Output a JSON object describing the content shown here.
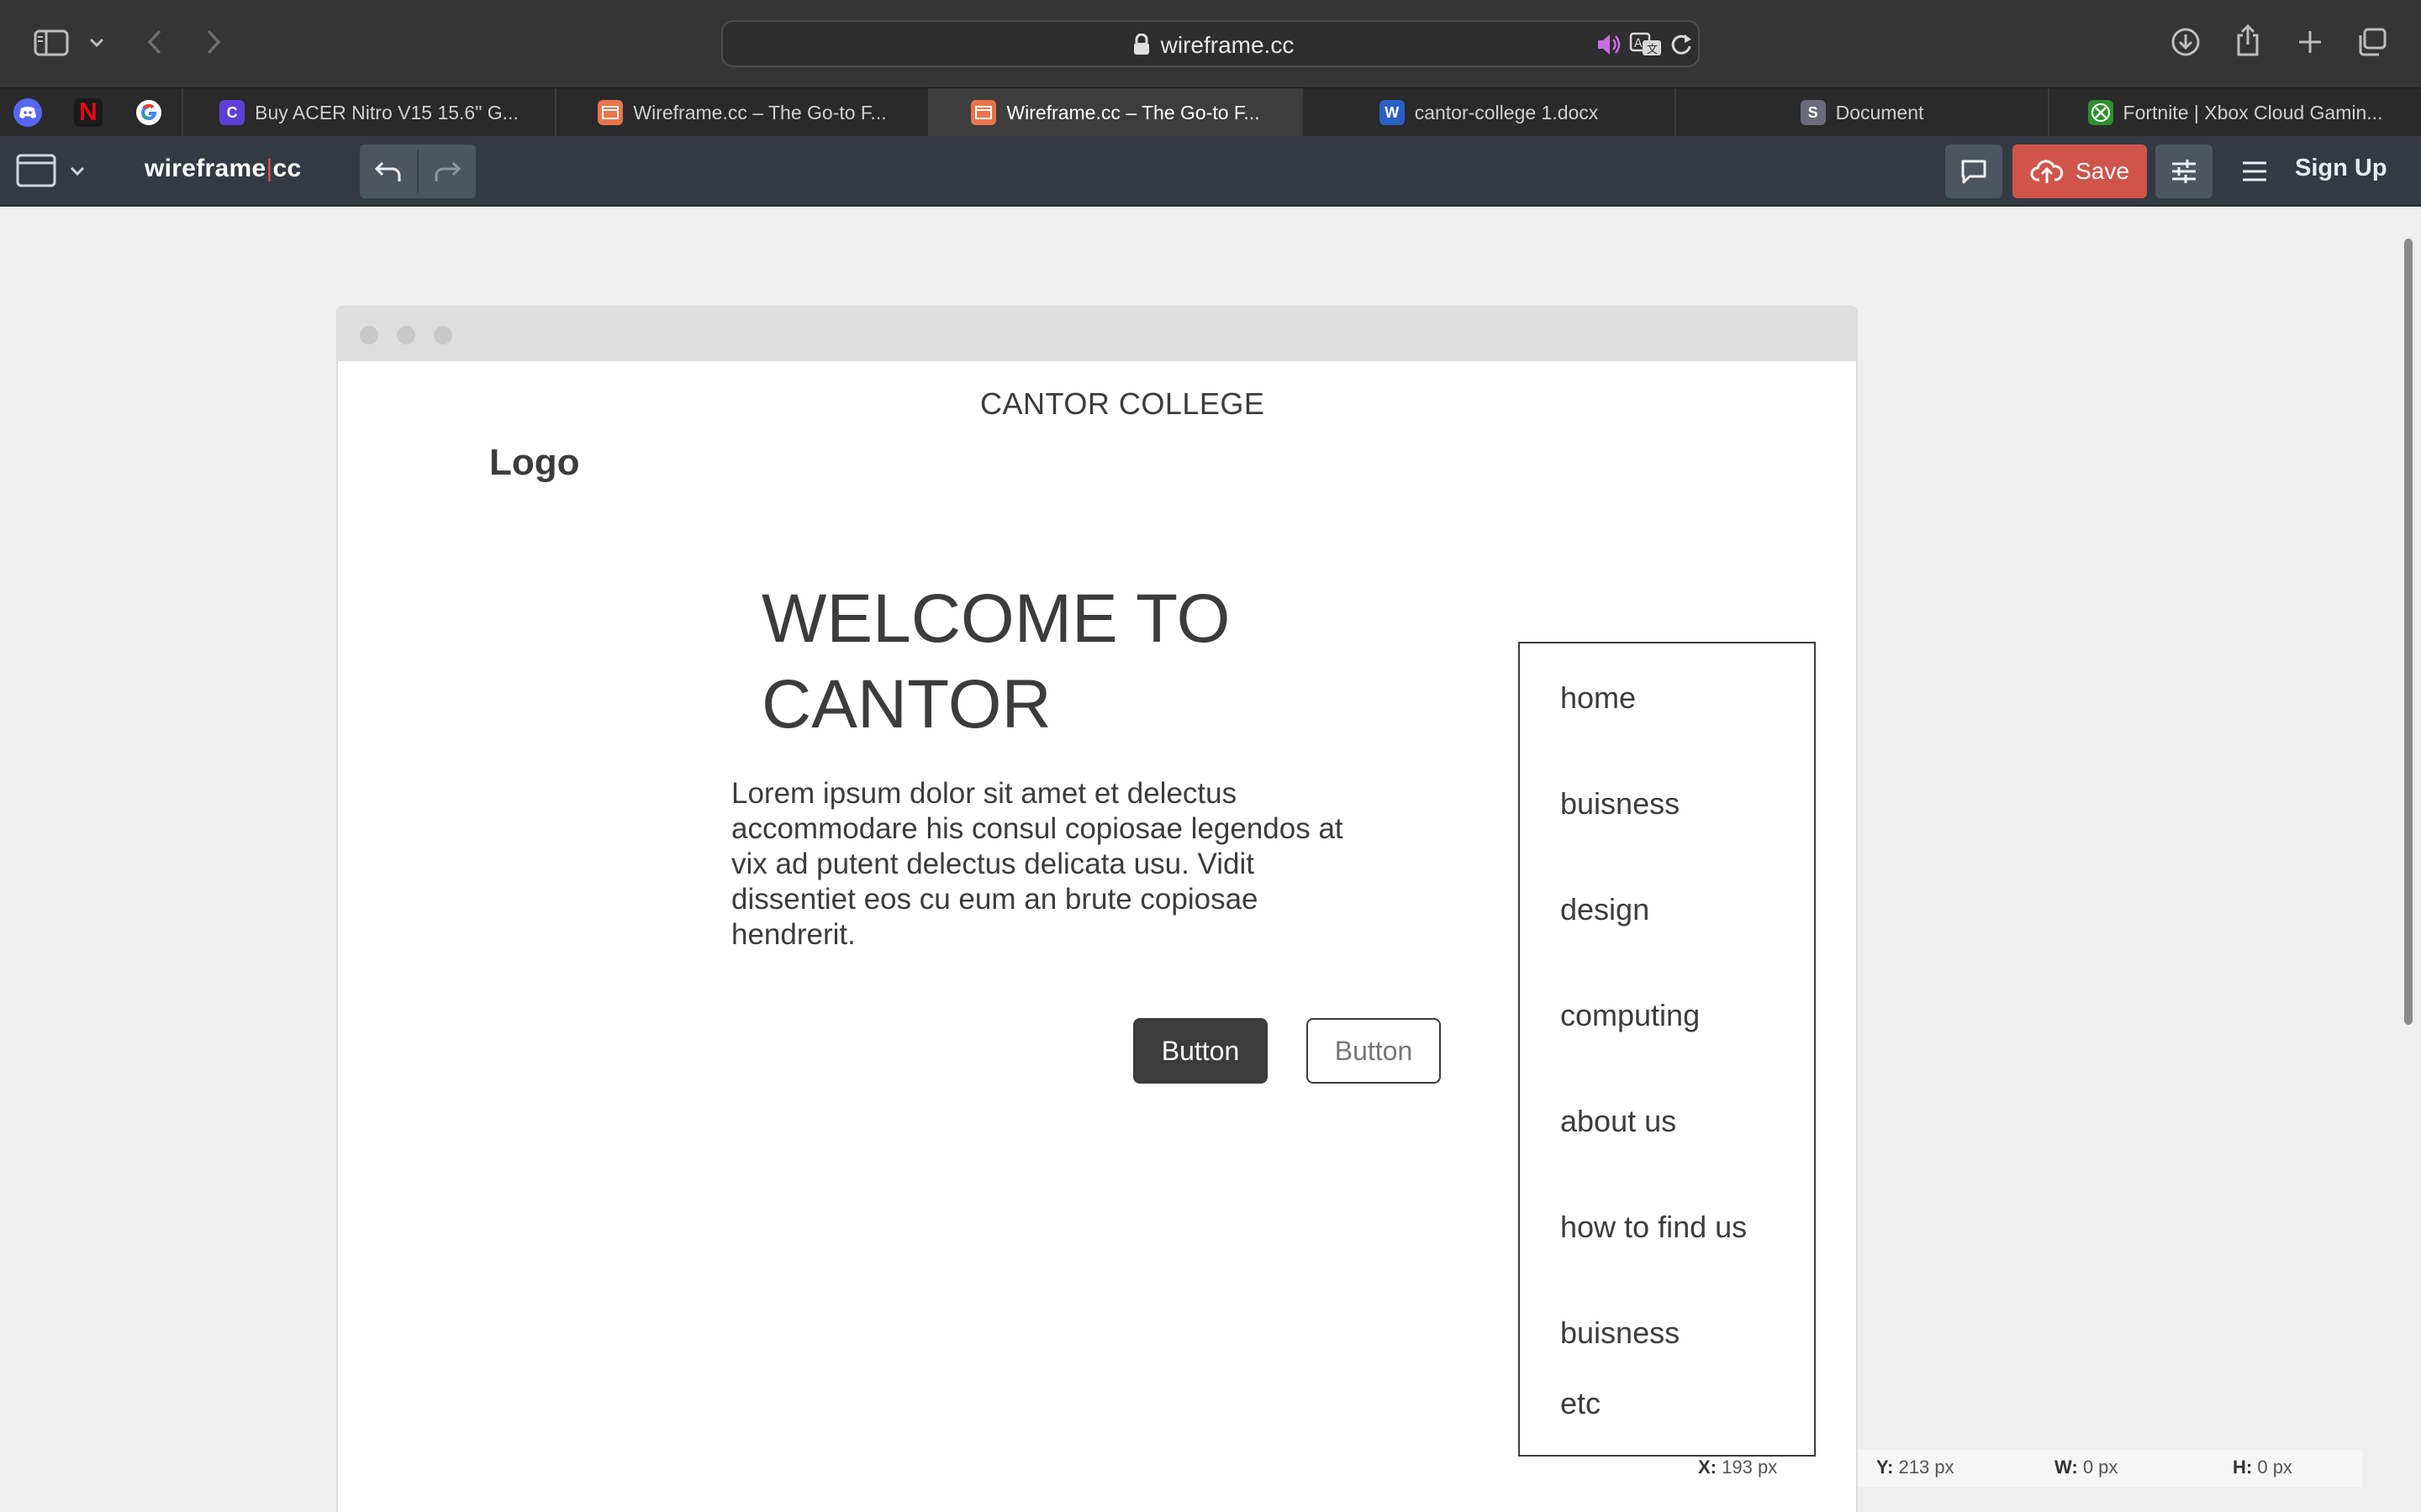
{
  "browser": {
    "url": "wireframe.cc",
    "tabs": [
      {
        "label": "Buy ACER Nitro V15 15.6\" G...",
        "icon": "c-favicon",
        "color": "#5b3fd6"
      },
      {
        "label": "Wireframe.cc – The Go-to F...",
        "icon": "wireframe-favicon",
        "color": "#e8744a"
      },
      {
        "label": "Wireframe.cc – The Go-to F...",
        "icon": "wireframe-favicon",
        "color": "#e8744a",
        "active": true
      },
      {
        "label": "cantor-college 1.docx",
        "icon": "word-favicon",
        "color": "#2b5fc4"
      },
      {
        "label": "Document",
        "icon": "s-favicon",
        "color": "#6a6a7a",
        "letter": "S"
      },
      {
        "label": "Fortnite | Xbox Cloud Gamin...",
        "icon": "xbox-favicon",
        "color": "#2f8f2f"
      }
    ],
    "pinned": [
      "discord-icon",
      "netflix-icon",
      "google-icon"
    ]
  },
  "toolbar": {
    "brand_left": "wireframe",
    "brand_pipe": "|",
    "brand_right": "cc",
    "save_label": "Save",
    "signup_label": "Sign Up"
  },
  "wireframe": {
    "college_title": "CANTOR COLLEGE",
    "logo": "Logo",
    "welcome_line1": "WELCOME TO",
    "welcome_line2": "CANTOR",
    "body": "Lorem ipsum dolor sit amet et delectus accommodare his consul copiosae legendos at vix ad putent delectus delicata usu. Vidit dissentiet eos cu eum an brute copiosae hendrerit.",
    "primary_button": "Button",
    "secondary_button": "Button",
    "nav": [
      "home",
      "buisness",
      "design",
      "computing",
      "about us",
      "how to find us",
      "buisness",
      "etc"
    ]
  },
  "readout": {
    "x_label": "X:",
    "x_value": "193 px",
    "y_label": "Y:",
    "y_value": "213 px",
    "w_label": "W:",
    "w_value": "0 px",
    "h_label": "H:",
    "h_value": "0 px"
  },
  "colors": {
    "save": "#d0544a",
    "toolbar": "#333a44",
    "ink": "#3c3c3c"
  }
}
